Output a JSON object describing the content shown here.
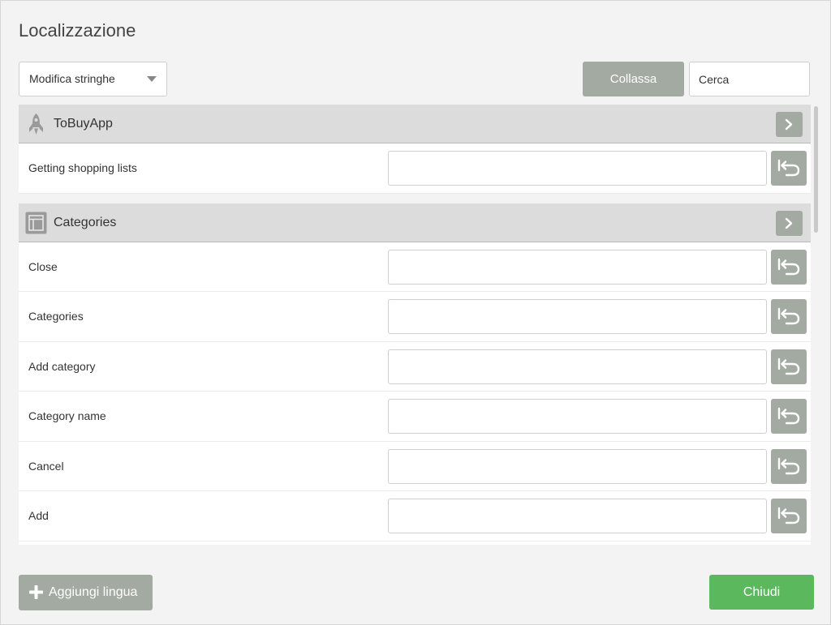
{
  "dialog": {
    "title": "Localizzazione"
  },
  "toolbar": {
    "mode_select": "Modifica stringhe",
    "collapse_label": "Collassa",
    "search_placeholder": "Cerca"
  },
  "groups": [
    {
      "title": "ToBuyApp",
      "icon": "rocket-icon",
      "rows": [
        {
          "label": "Getting shopping lists",
          "value": ""
        }
      ]
    },
    {
      "title": "Categories",
      "icon": "layout-icon",
      "rows": [
        {
          "label": "Close",
          "value": ""
        },
        {
          "label": "Categories",
          "value": ""
        },
        {
          "label": "Add category",
          "value": ""
        },
        {
          "label": "Category name",
          "value": ""
        },
        {
          "label": "Cancel",
          "value": ""
        },
        {
          "label": "Add",
          "value": ""
        }
      ]
    }
  ],
  "footer": {
    "add_language_label": "Aggiungi lingua",
    "close_label": "Chiudi"
  },
  "colors": {
    "neutral_button": "#a2aaa2",
    "primary_button": "#5cb85c",
    "group_header_bg": "#dcdcdc"
  }
}
